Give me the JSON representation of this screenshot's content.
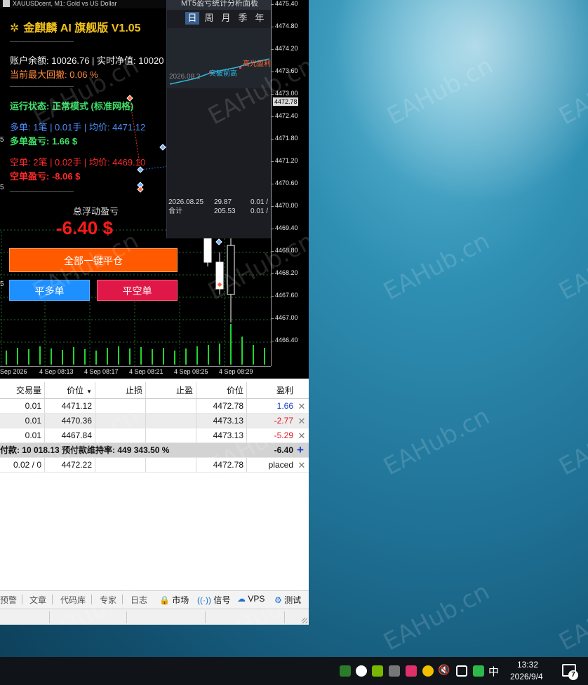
{
  "window": {
    "title": "XAUUSDcent, M1: Gold vs US Dollar"
  },
  "chart": {
    "price_ticks": [
      "4475.40",
      "4474.80",
      "4474.20",
      "4473.60",
      "4473.00",
      "4472.40",
      "4471.80",
      "4471.20",
      "4470.60",
      "4470.00",
      "4469.40",
      "4468.80",
      "4468.20",
      "4467.60",
      "4467.00",
      "4466.40"
    ],
    "current_price": "4472.78",
    "time_ticks": [
      "Sep 2026",
      "4 Sep 08:13",
      "4 Sep 08:17",
      "4 Sep 08:21",
      "4 Sep 08:25",
      "4 Sep 08:29"
    ],
    "left_axis_marks": [
      "5",
      "5",
      "5"
    ]
  },
  "ea": {
    "title": "金麒麟 AI 旗舰版 V1.05",
    "separator": "——————————",
    "balance_line": "账户余额: 10026.76 | 实时净值: 10020",
    "max_drawdown": "当前最大回撤: 0.06 %",
    "status": "运行状态: 正常模式 (标准网格)",
    "long_orders": "多单: 1笔 | 0.01手 | 均价: 4471.12",
    "long_pnl": "多单盈亏: 1.66 $",
    "short_orders": "空单: 2笔 | 0.02手 | 均价: 4469.10",
    "short_pnl": "空单盈亏: -8.06 $",
    "float_label": "总浮动盈亏",
    "float_value": "-6.40 $",
    "btn_close_all": "全部一键平仓",
    "btn_close_long": "平多单",
    "btn_close_short": "平空单"
  },
  "stats": {
    "title": "MT5盈亏统计分析面板",
    "periods": [
      "日",
      "周",
      "月",
      "季",
      "年"
    ],
    "active_period": "日",
    "mini_date": "2026.08.2",
    "annotation1": "突破前高",
    "annotation2": "高光盈利",
    "rows": [
      {
        "c1": "2026.08.25",
        "c2": "29.87",
        "c3": "0.01 /"
      },
      {
        "c1": "合计",
        "c2": "205.53",
        "c3": "0.01 /"
      }
    ]
  },
  "table": {
    "headers": {
      "volume": "交易量",
      "price": "价位",
      "sl": "止损",
      "tp": "止盈",
      "current": "价位",
      "profit": "盈利"
    },
    "rows": [
      {
        "volume": "0.01",
        "price": "4471.12",
        "sl": "",
        "tp": "",
        "current": "4472.78",
        "profit": "1.66",
        "tone": "blue"
      },
      {
        "volume": "0.01",
        "price": "4470.36",
        "sl": "",
        "tp": "",
        "current": "4473.13",
        "profit": "-2.77",
        "tone": "red"
      },
      {
        "volume": "0.01",
        "price": "4467.84",
        "sl": "",
        "tp": "",
        "current": "4473.13",
        "profit": "-5.29",
        "tone": "red"
      }
    ],
    "summary": "付款: 10 018.13  预付款维持率: 449 343.50 %",
    "summary_profit": "-6.40",
    "pending": {
      "volume": "0.02 / 0",
      "price": "4472.22",
      "current": "4472.78",
      "profit": "placed"
    }
  },
  "tabs": [
    "预警",
    "文章",
    "代码库",
    "专家",
    "日志",
    "市场",
    "信号",
    "VPS",
    "测试"
  ],
  "taskbar": {
    "ime": "中",
    "time": "13:32",
    "date": "2026/9/4",
    "notifications": "7"
  },
  "watermark": "EAHub.cn",
  "colors": {
    "ea_gold": "#f2c21b",
    "profit_blue": "#1a3fc8",
    "loss_red": "#e0101a",
    "close_all_orange": "#ff5a00"
  }
}
